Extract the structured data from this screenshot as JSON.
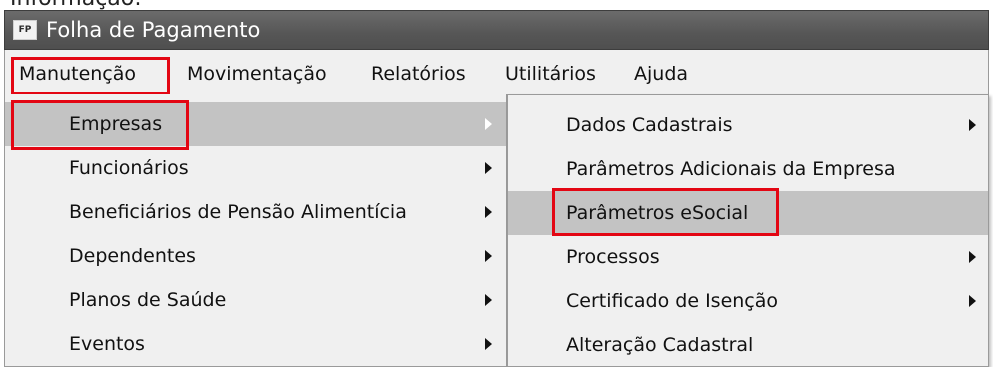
{
  "page_top_text": "Informação:",
  "window": {
    "icon_text": "FP",
    "title": "Folha de Pagamento"
  },
  "menubar": {
    "items": [
      {
        "label": "Manutenção"
      },
      {
        "label": "Movimentação"
      },
      {
        "label": "Relatórios"
      },
      {
        "label": "Utilitários"
      },
      {
        "label": "Ajuda"
      }
    ]
  },
  "manutencao_menu": {
    "items": [
      {
        "label": "Empresas",
        "submenu": true,
        "selected": true
      },
      {
        "label": "Funcionários",
        "submenu": true
      },
      {
        "label": "Beneficiários de Pensão Alimentícia",
        "submenu": true
      },
      {
        "label": "Dependentes",
        "submenu": true
      },
      {
        "label": "Planos de Saúde",
        "submenu": true
      },
      {
        "label": "Eventos",
        "submenu": true
      }
    ]
  },
  "empresas_submenu": {
    "items": [
      {
        "label": "Dados Cadastrais",
        "submenu": true
      },
      {
        "label": "Parâmetros Adicionais da Empresa",
        "submenu": false
      },
      {
        "label": "Parâmetros eSocial",
        "submenu": false,
        "selected": true
      },
      {
        "label": "Processos",
        "submenu": true
      },
      {
        "label": "Certificado de Isenção",
        "submenu": true
      },
      {
        "label": "Alteração Cadastral",
        "submenu": false
      }
    ]
  },
  "colors": {
    "highlight_border": "#e30613",
    "titlebar": "#5a5a5a",
    "menu_background": "#f0f0f0",
    "selected_row": "#c3c3c3"
  }
}
